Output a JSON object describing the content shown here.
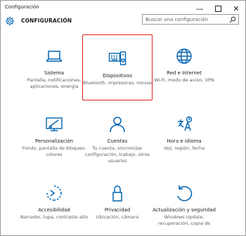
{
  "window": {
    "title": "Configuración",
    "minimize": "—",
    "close": "✕"
  },
  "header": {
    "title": "CONFIGURACIÓN",
    "search_placeholder": "Buscar una configuración"
  },
  "accent": "#0063b1",
  "selection_color": "#e02020",
  "tiles": [
    {
      "name": "Sistema",
      "desc": "Pantalla, notificaciones, aplicaciones, energía",
      "icon": "laptop-icon"
    },
    {
      "name": "Dispositivos",
      "desc": "Bluetooth, impresoras, mouse",
      "icon": "keyboard-speaker-icon",
      "selected": true
    },
    {
      "name": "Red e Internet",
      "desc": "Wi-Fi, modo de avión, VPN",
      "icon": "globe-icon"
    },
    {
      "name": "Personalización",
      "desc": "Fondo, pantalla de bloqueo, colores",
      "icon": "monitor-brush-icon"
    },
    {
      "name": "Cuentas",
      "desc": "Tu cuenta, sincronizar configuración, trabajo, otros usuarios",
      "icon": "person-icon"
    },
    {
      "name": "Hora e idioma",
      "desc": "Voz, región, fecha",
      "icon": "time-language-icon"
    },
    {
      "name": "Accesibilidad",
      "desc": "Narrador, lupa, contraste alto",
      "icon": "ease-of-access-icon"
    },
    {
      "name": "Privacidad",
      "desc": "Ubicación, cámara",
      "icon": "lock-icon"
    },
    {
      "name": "Actualización y seguridad",
      "desc": "Windows Update, recuperación, copia de",
      "icon": "update-icon"
    }
  ]
}
